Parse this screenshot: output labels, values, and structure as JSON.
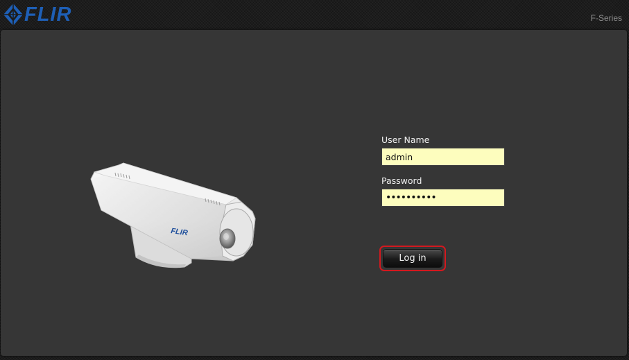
{
  "header": {
    "brand": "FLIR",
    "product": "F-Series",
    "logo_icon": "flir-diamond-logo-icon"
  },
  "login": {
    "username_label": "User Name",
    "username_value": "admin",
    "password_label": "Password",
    "password_value": "••••••••••",
    "submit_label": "Log in"
  },
  "camera_image": {
    "brand_on_housing": "FLIR"
  },
  "colors": {
    "brand_blue": "#1e5fb6",
    "panel_bg": "#363636",
    "input_bg": "#fdfdbe",
    "highlight_red": "#d4181e"
  }
}
